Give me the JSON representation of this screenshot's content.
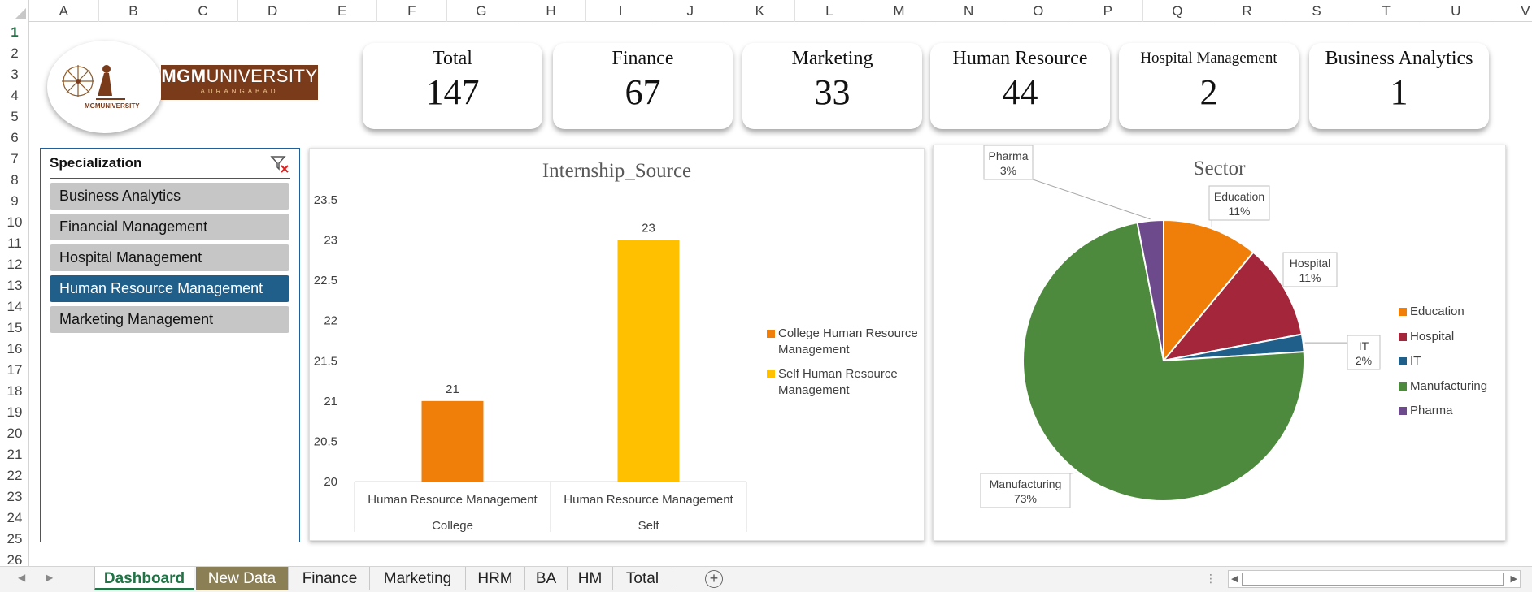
{
  "columns": [
    "A",
    "B",
    "C",
    "D",
    "E",
    "F",
    "G",
    "H",
    "I",
    "J",
    "K",
    "L",
    "M",
    "N",
    "O",
    "P",
    "Q",
    "R",
    "S",
    "T",
    "U",
    "V"
  ],
  "rows": [
    "1",
    "2",
    "3",
    "4",
    "5",
    "6",
    "7",
    "8",
    "9",
    "10",
    "11",
    "12",
    "13",
    "14",
    "15",
    "16",
    "17",
    "18",
    "19",
    "20",
    "21",
    "22",
    "23",
    "24",
    "25",
    "26"
  ],
  "logo": {
    "name_bold": "MGM",
    "name_light": "UNIVERSITY",
    "city": "AURANGABAD",
    "small_text": "MGMUNIVERSITY"
  },
  "kpis": [
    {
      "title": "Total",
      "value": "147"
    },
    {
      "title": "Finance",
      "value": "67"
    },
    {
      "title": "Marketing",
      "value": "33"
    },
    {
      "title": "Human Resource",
      "value": "44"
    },
    {
      "title": "Hospital Management",
      "value": "2"
    },
    {
      "title": "Business Analytics",
      "value": "1"
    }
  ],
  "slicer": {
    "title": "Specialization",
    "clear_icon": "filter-clear-icon",
    "items": [
      "Business Analytics",
      "Financial Management",
      "Hospital Management",
      "Human Resource Management",
      "Marketing Management"
    ],
    "selected": "Human Resource Management"
  },
  "chart_data": [
    {
      "type": "bar",
      "title": "Internship_Source",
      "categories": [
        "College",
        "Self"
      ],
      "subcategory_label": "Human Resource Management",
      "series": [
        {
          "name": "College Human Resource Management",
          "values": [
            21,
            null
          ],
          "color": "#f07f09"
        },
        {
          "name": "Self Human Resource Management",
          "values": [
            null,
            23
          ],
          "color": "#ffc000"
        }
      ],
      "ylim": [
        20,
        23.5
      ],
      "yticks": [
        "20",
        "20.5",
        "21",
        "21.5",
        "22",
        "22.5",
        "23",
        "23.5"
      ],
      "data_labels": [
        "21",
        "23"
      ],
      "legend": "right",
      "grid": false
    },
    {
      "type": "pie",
      "title": "Sector",
      "labels": [
        "Education",
        "Hospital",
        "IT",
        "Manufacturing",
        "Pharma"
      ],
      "values": [
        11,
        11,
        2,
        73,
        3
      ],
      "percent_labels": [
        "11%",
        "11%",
        "2%",
        "73%",
        "3%"
      ],
      "colors": [
        "#f07f09",
        "#a3263a",
        "#1f5f8a",
        "#4e8a3e",
        "#6c4a8c"
      ],
      "legend": "right"
    }
  ],
  "sheet_tabs": [
    {
      "label": "Dashboard",
      "active": true
    },
    {
      "label": "New Data",
      "colored": true
    },
    {
      "label": "Finance"
    },
    {
      "label": "Marketing"
    },
    {
      "label": "HRM"
    },
    {
      "label": "BA"
    },
    {
      "label": "HM"
    },
    {
      "label": "Total"
    }
  ],
  "add_sheet_label": "+",
  "nav_prev": "◀",
  "nav_next": "▶",
  "tab_more": "⋮",
  "scroll_left": "◀",
  "scroll_right": "▶"
}
